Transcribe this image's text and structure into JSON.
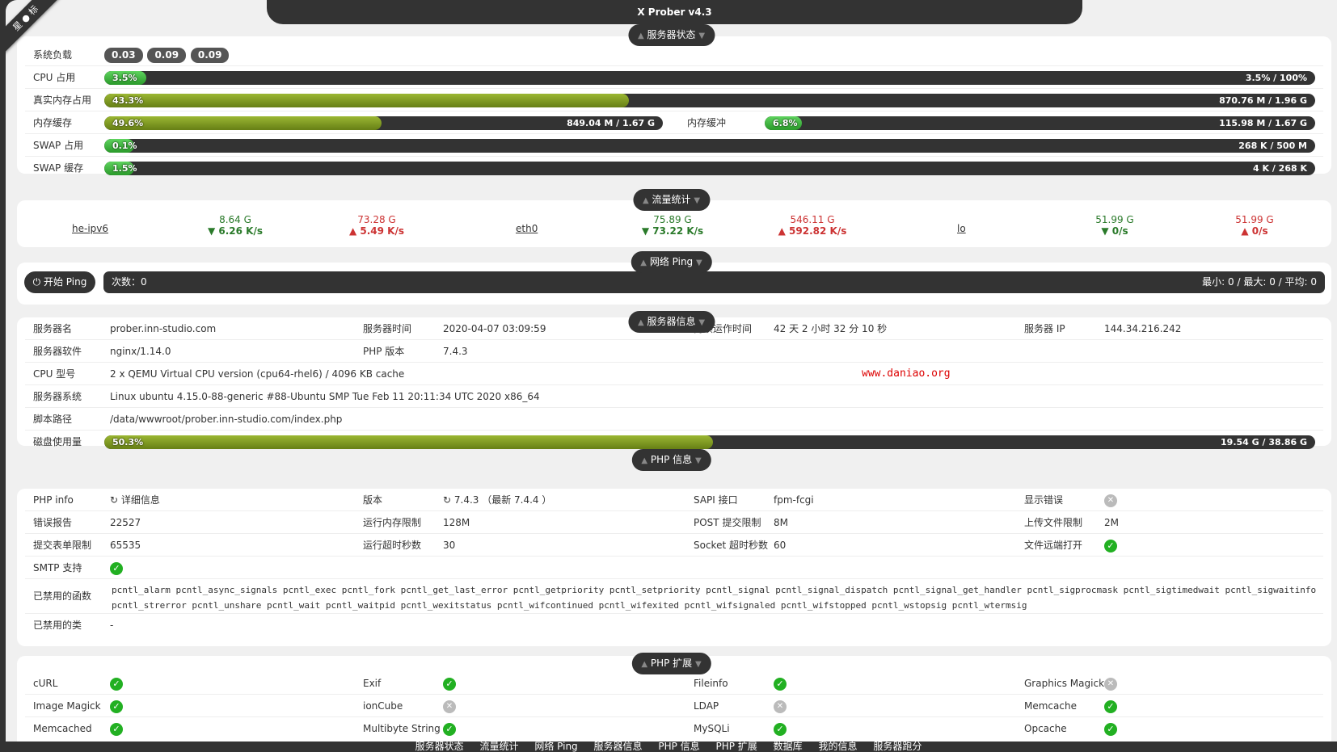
{
  "window": {
    "title": "X Prober v4.3",
    "ribbon": "星 ● 标"
  },
  "sections": {
    "server_status": "服务器状态",
    "traffic": "流量统计",
    "ping": "网络 Ping",
    "server_info": "服务器信息",
    "php_info": "PHP 信息",
    "php_ext": "PHP 扩展"
  },
  "status": {
    "load_label": "系统负载",
    "load": [
      "0.03",
      "0.09",
      "0.09"
    ],
    "cpu": {
      "label": "CPU 占用",
      "pct": "3.5%",
      "value": 3.5,
      "right": "3.5% / 100%"
    },
    "real_mem": {
      "label": "真实内存占用",
      "pct": "43.3%",
      "value": 43.3,
      "right": "870.76 M / 1.96 G"
    },
    "mem_cache": {
      "label": "内存缓存",
      "pct": "49.6%",
      "value": 49.6,
      "right": "849.04 M / 1.67 G"
    },
    "mem_buffer": {
      "label": "内存缓冲",
      "pct": "6.8%",
      "value": 6.8,
      "right": "115.98 M / 1.67 G"
    },
    "swap_used": {
      "label": "SWAP 占用",
      "pct": "0.1%",
      "value": 0.1,
      "right": "268 K / 500 M"
    },
    "swap_cache": {
      "label": "SWAP 缓存",
      "pct": "1.5%",
      "value": 1.5,
      "right": "4 K / 268 K"
    }
  },
  "traffic": [
    {
      "iface": "he-ipv6",
      "rx_total": "8.64 G",
      "rx_rate": "▼ 6.26 K/s",
      "tx_total": "73.28 G",
      "tx_rate": "▲ 5.49 K/s"
    },
    {
      "iface": "eth0",
      "rx_total": "75.89 G",
      "rx_rate": "▼ 73.22 K/s",
      "tx_total": "546.11 G",
      "tx_rate": "▲ 592.82 K/s"
    },
    {
      "iface": "lo",
      "rx_total": "51.99 G",
      "rx_rate": "▼ 0/s",
      "tx_total": "51.99 G",
      "tx_rate": "▲ 0/s"
    }
  ],
  "ping": {
    "button": "开始 Ping",
    "count": "次数：0",
    "stats": "最小: 0 / 最大: 0 / 平均: 0"
  },
  "server_info": {
    "name_label": "服务器名",
    "name": "prober.inn-studio.com",
    "time_label": "服务器时间",
    "time": "2020-04-07 03:09:59",
    "uptime_label": "持续运作时间",
    "uptime": "42 天 2 小时 32 分 10 秒",
    "ip_label": "服务器 IP",
    "ip": "144.34.216.242",
    "soft_label": "服务器软件",
    "soft": "nginx/1.14.0",
    "php_label": "PHP 版本",
    "php": "7.4.3",
    "cpu_label": "CPU 型号",
    "cpu": "2 x QEMU Virtual CPU version (cpu64-rhel6) / 4096 KB cache",
    "os_label": "服务器系统",
    "os": "Linux ubuntu 4.15.0-88-generic #88-Ubuntu SMP Tue Feb 11 20:11:34 UTC 2020 x86_64",
    "path_label": "脚本路径",
    "path": "/data/wwwroot/prober.inn-studio.com/index.php",
    "disk_label": "磁盘使用量",
    "disk_pct": "50.3%",
    "disk_value": 50.3,
    "disk_right": "19.54 G / 38.86 G",
    "watermark": "www.daniao.org"
  },
  "php": {
    "info_label": "PHP info",
    "info_value": "↻ 详细信息",
    "version_label": "版本",
    "version_value": "↻ 7.4.3 （最新 7.4.4 ）",
    "sapi_label": "SAPI 接口",
    "sapi_value": "fpm-fcgi",
    "display_errors_label": "显示错误",
    "error_report_label": "错误报告",
    "error_report_value": "22527",
    "mem_limit_label": "运行内存限制",
    "mem_limit_value": "128M",
    "post_label": "POST 提交限制",
    "post_value": "8M",
    "upload_label": "上传文件限制",
    "upload_value": "2M",
    "form_label": "提交表单限制",
    "form_value": "65535",
    "timeout_label": "运行超时秒数",
    "timeout_value": "30",
    "socket_label": "Socket 超时秒数",
    "socket_value": "60",
    "remote_label": "文件远端打开",
    "smtp_label": "SMTP 支持",
    "disabled_funcs_label": "已禁用的函数",
    "disabled_funcs_line1": "pcntl_alarm pcntl_async_signals pcntl_exec pcntl_fork pcntl_get_last_error pcntl_getpriority pcntl_setpriority pcntl_signal pcntl_signal_dispatch pcntl_signal_get_handler pcntl_sigprocmask pcntl_sigtimedwait pcntl_sigwaitinfo",
    "disabled_funcs_line2": "pcntl_strerror pcntl_unshare pcntl_wait pcntl_waitpid pcntl_wexitstatus pcntl_wifcontinued pcntl_wifexited pcntl_wifsignaled pcntl_wifstopped pcntl_wstopsig pcntl_wtermsig",
    "disabled_classes_label": "已禁用的类",
    "disabled_classes_value": "-"
  },
  "ext": {
    "curl": "cURL",
    "exif": "Exif",
    "fileinfo": "Fileinfo",
    "gmagick": "Graphics Magick",
    "imagick": "Image Magick",
    "ioncube": "ionCube",
    "ldap": "LDAP",
    "memcache": "Memcache",
    "memcached": "Memcached",
    "mbstring": "Multibyte String",
    "mysqli": "MySQLi",
    "opcache": "Opcache"
  },
  "footer": [
    "服务器状态",
    "流量统计",
    "网络 Ping",
    "服务器信息",
    "PHP 信息",
    "PHP 扩展",
    "数据库",
    "我的信息",
    "服务器跑分"
  ]
}
